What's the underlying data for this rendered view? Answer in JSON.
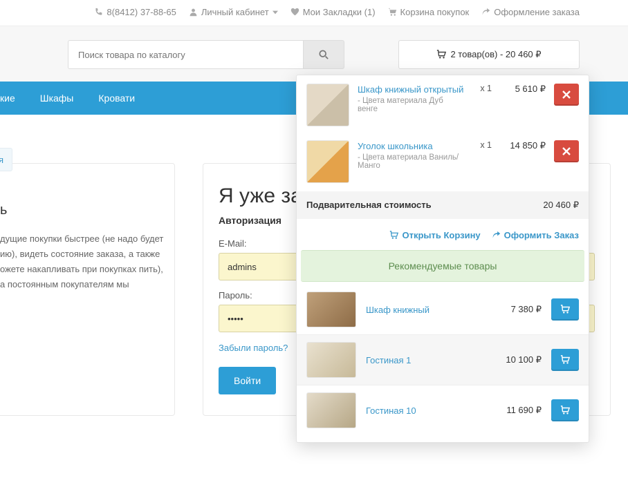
{
  "topbar": {
    "phone": "8(8412) 37-88-65",
    "account": "Личный кабинет",
    "wishlist": "Мои Закладки (1)",
    "cart": "Корзина покупок",
    "checkout": "Оформление заказа"
  },
  "search": {
    "placeholder": "Поиск товара по каталогу"
  },
  "cart_button": "2 товар(ов) - 20 460 ₽",
  "nav": {
    "item0": "кие",
    "item1": "Шкафы",
    "item2": "Кровати"
  },
  "breadcrumb": "я",
  "left_text": "дущие покупки быстрее (не надо будет ию), видеть состояние заказа, а также ожете накапливать при покупках пить), а постоянным покупателям мы",
  "login": {
    "title": "Я уже за",
    "subtitle": "Авторизация",
    "email_label": "E-Mail:",
    "email_value": "admins",
    "password_label": "Пароль:",
    "password_value": "•••••",
    "forgot": "Забыли пароль?",
    "submit": "Войти"
  },
  "cart_dd": {
    "items": [
      {
        "name": "Шкаф книжный открытый",
        "sub": "- Цвета материала Дуб венге",
        "qty": "x 1",
        "price": "5 610 ₽"
      },
      {
        "name": "Уголок школьника",
        "sub": "- Цвета материала Ваниль/Манго",
        "qty": "x 1",
        "price": "14 850 ₽"
      }
    ],
    "subtotal_label": "Подварительная стоимость",
    "subtotal_value": "20 460 ₽",
    "open_cart": "Открыть Корзину",
    "checkout": "Оформить Заказ",
    "reco_title": "Рекомендуемые товары",
    "reco": [
      {
        "name": "Шкаф книжный",
        "price": "7 380 ₽"
      },
      {
        "name": "Гостиная 1",
        "price": "10 100 ₽"
      },
      {
        "name": "Гостиная 10",
        "price": "11 690 ₽"
      }
    ]
  }
}
